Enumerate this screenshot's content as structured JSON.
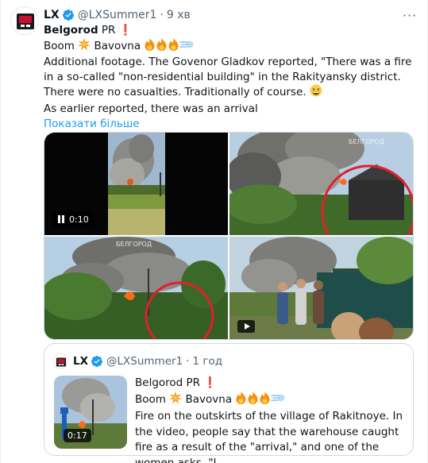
{
  "tweet": {
    "author_name": "LX",
    "handle": "@LXSummer1",
    "dot": "·",
    "time": "9 хв",
    "line1_bold": "Belgorod",
    "line1_rest": " PR ",
    "line1_excl": "❗",
    "line2_a": "Boom ",
    "line2_b": " Bavovna ",
    "line3": "Additional footage. The Govenor Gladkov reported, \"There was a fire in a so-called \"non-residential building\" in the Rakityansky district. There were no casualties. Traditionally of course. ",
    "line4": "As earlier reported, there was an arrival",
    "show_more": "Показати більше",
    "more_menu": "···"
  },
  "media": {
    "video_time": "0:10",
    "watermark": "БЕЛГОРОД"
  },
  "quote": {
    "author_name": "LX",
    "handle": "@LXSummer1",
    "dot": "·",
    "time": "1 год",
    "line1": "Belgorod PR ",
    "line1_excl": "❗",
    "line2_a": "Boom ",
    "line2_b": " Bavovna ",
    "body": "Fire on the outskirts of the village of Rakitnoye. In the video, people say that the warehouse caught fire as a result of the \"arrival,\" and one of the women asks, \"I ...",
    "video_time": "0:17"
  },
  "colors": {
    "link": "#1d9bf0",
    "verified": "#1d9bf0",
    "muted": "#536471",
    "border": "#cfd9de"
  },
  "icons": [
    "verified-badge-icon",
    "collision-icon",
    "fire-icon",
    "dash-icon",
    "grin-icon",
    "pause-icon",
    "play-icon",
    "more-icon"
  ]
}
